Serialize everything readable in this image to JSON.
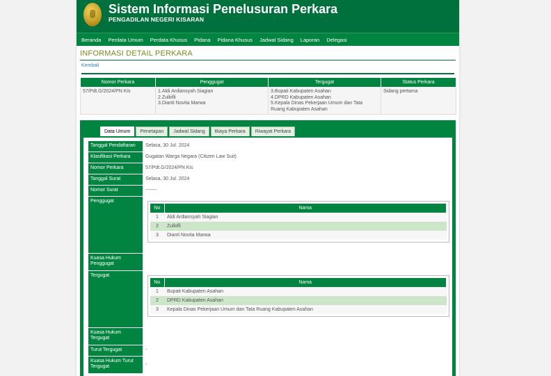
{
  "header": {
    "title": "Sistem Informasi Penelusuran Perkara",
    "subtitle": "PENGADILAN NEGERI KISARAN"
  },
  "nav": [
    "Beranda",
    "Perdata Umum",
    "Perdata Khusus",
    "Pidana",
    "Pidana Khusus",
    "Jadwal Sidang",
    "Laporan",
    "Delegasi"
  ],
  "section_title": "INFORMASI DETAIL PERKARA",
  "back_link": "Kembali",
  "summary": {
    "headers": [
      "Nomor Perkara",
      "Penggugat",
      "Tergugat",
      "Status Perkara"
    ],
    "nomor": "57/Pdt.G/2024/PN Kis",
    "penggugat": [
      "1.Aldi Ardiansyah Siagian",
      "2.Zulkifli",
      "3.Dianti Novita Marwa"
    ],
    "tergugat": [
      "3.Bupati Kabupaten Asahan",
      "4.DPRD Kabupaten Asahan",
      "5.Kepala Dinas Pekerjaan Umum dan Tata",
      "Ruang Kabupaten Asahan"
    ],
    "status": "Sidang pertama"
  },
  "tabs": [
    "Data Umum",
    "Penetapan",
    "Jadwal Sidang",
    "Biaya Perkara",
    "Riwayat Perkara"
  ],
  "details": {
    "tanggal_pendaftaran": {
      "label": "Tanggal Pendaftaran",
      "value": "Selasa, 30 Jul. 2024"
    },
    "klasifikasi": {
      "label": "Klasifikasi Perkara",
      "value": "Gugatan Warga Negara (Citizen Law Suit)"
    },
    "nomor": {
      "label": "Nomor Perkara",
      "value": "57/Pdt.G/2024/PN Kis"
    },
    "tanggal_surat": {
      "label": "Tanggal Surat",
      "value": "Selasa, 30 Jul. 2024"
    },
    "nomor_surat": {
      "label": "Nomor Surat",
      "value": "-------"
    },
    "penggugat": {
      "label": "Penggugat"
    },
    "kuasa_penggugat": {
      "label": "Kuasa Hukum Penggugat"
    },
    "tergugat": {
      "label": "Tergugat"
    },
    "kuasa_tergugat": {
      "label": "Kuasa Hukum Tergugat"
    },
    "turut_tergugat": {
      "label": "Turut Tergugat",
      "value": "-"
    },
    "kuasa_turut": {
      "label": "Kuasa Hukum Turut Tergugat",
      "value": "-"
    }
  },
  "party_table_headers": [
    "No",
    "Nama"
  ],
  "penggugat_list": [
    {
      "no": "1",
      "nama": "Aldi Ardiansyah Siagian"
    },
    {
      "no": "2",
      "nama": "Zulkifli"
    },
    {
      "no": "3",
      "nama": "Dianti Novita Marwa"
    }
  ],
  "tergugat_list": [
    {
      "no": "1",
      "nama": "Bupati Kabupaten Asahan"
    },
    {
      "no": "2",
      "nama": "DPRD Kabupaten Asahan"
    },
    {
      "no": "3",
      "nama": "Kepala Dinas Pekerjaan Umum dan Tata Ruang Kabupaten Asahan"
    }
  ],
  "colors": {
    "primary": "#00703c",
    "nav": "#00843f",
    "alt_row": "#cde6c9",
    "title": "#7a8a1e"
  }
}
